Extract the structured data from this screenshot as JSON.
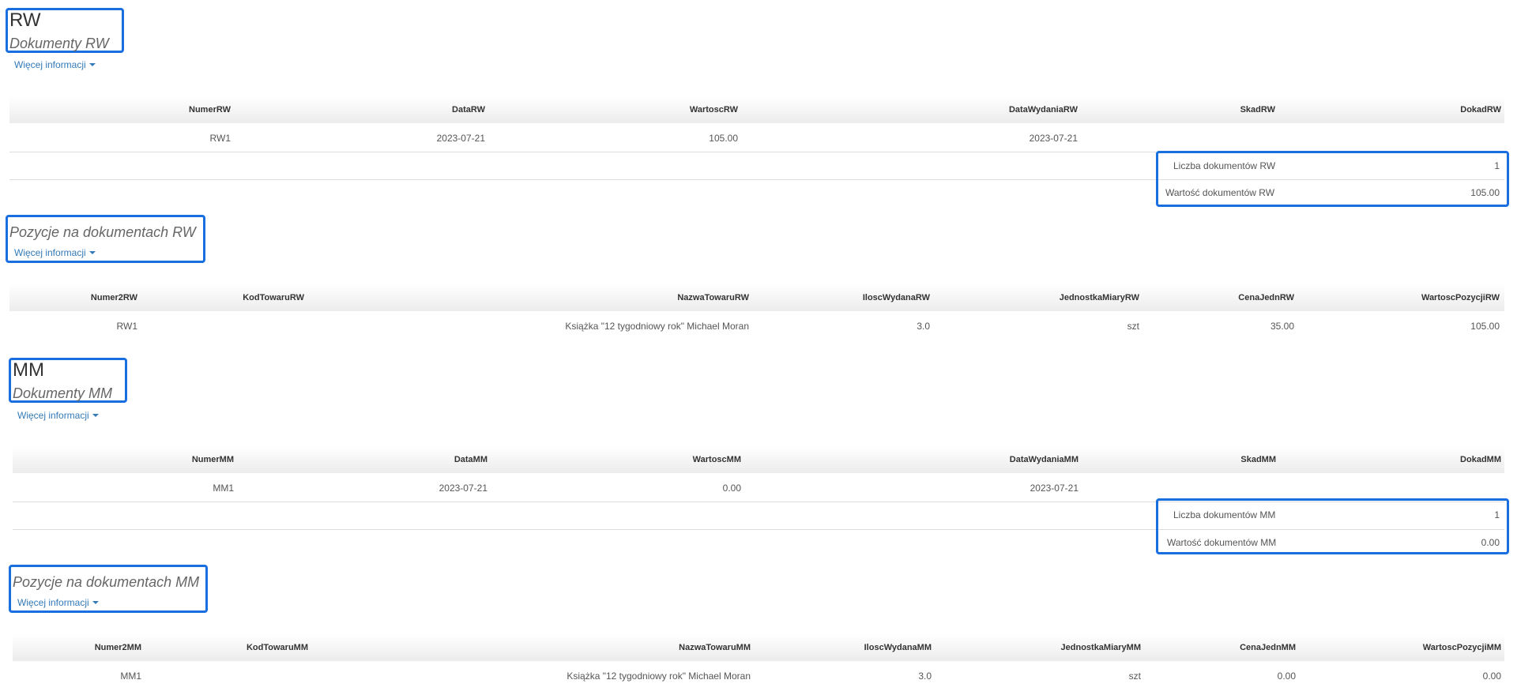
{
  "more_info_label": "Więcej informacji",
  "accent_color": "#1a6fe0",
  "rw": {
    "title": "RW",
    "subtitle": "Dokumenty RW",
    "headers": [
      "NumerRW",
      "DataRW",
      "WartoscRW",
      "DataWydaniaRW",
      "SkadRW",
      "DokadRW"
    ],
    "row": [
      "RW1",
      "2023-07-21",
      "105.00",
      "2023-07-21",
      "",
      ""
    ],
    "summary": [
      {
        "label": "Liczba dokumentów RW",
        "value": "1"
      },
      {
        "label": "Wartość dokumentów RW",
        "value": "105.00"
      }
    ]
  },
  "rw_items": {
    "subtitle": "Pozycje na dokumentach RW",
    "headers": [
      "Numer2RW",
      "KodTowaruRW",
      "NazwaTowaruRW",
      "IloscWydanaRW",
      "JednostkaMiaryRW",
      "CenaJednRW",
      "WartoscPozycjiRW"
    ],
    "row": [
      "RW1",
      "",
      "Książka \"12 tygodniowy rok\" Michael Moran",
      "3.0",
      "szt",
      "35.00",
      "105.00"
    ]
  },
  "mm": {
    "title": "MM",
    "subtitle": "Dokumenty MM",
    "headers": [
      "NumerMM",
      "DataMM",
      "WartoscMM",
      "DataWydaniaMM",
      "SkadMM",
      "DokadMM"
    ],
    "row": [
      "MM1",
      "2023-07-21",
      "0.00",
      "2023-07-21",
      "",
      ""
    ],
    "summary": [
      {
        "label": "Liczba dokumentów MM",
        "value": "1"
      },
      {
        "label": "Wartość dokumentów MM",
        "value": "0.00"
      }
    ]
  },
  "mm_items": {
    "subtitle": "Pozycje na dokumentach MM",
    "headers": [
      "Numer2MM",
      "KodTowaruMM",
      "NazwaTowaruMM",
      "IloscWydanaMM",
      "JednostkaMiaryMM",
      "CenaJednMM",
      "WartoscPozycjiMM"
    ],
    "row": [
      "MM1",
      "",
      "Książka \"12 tygodniowy rok\" Michael Moran",
      "3.0",
      "szt",
      "0.00",
      "0.00"
    ]
  }
}
